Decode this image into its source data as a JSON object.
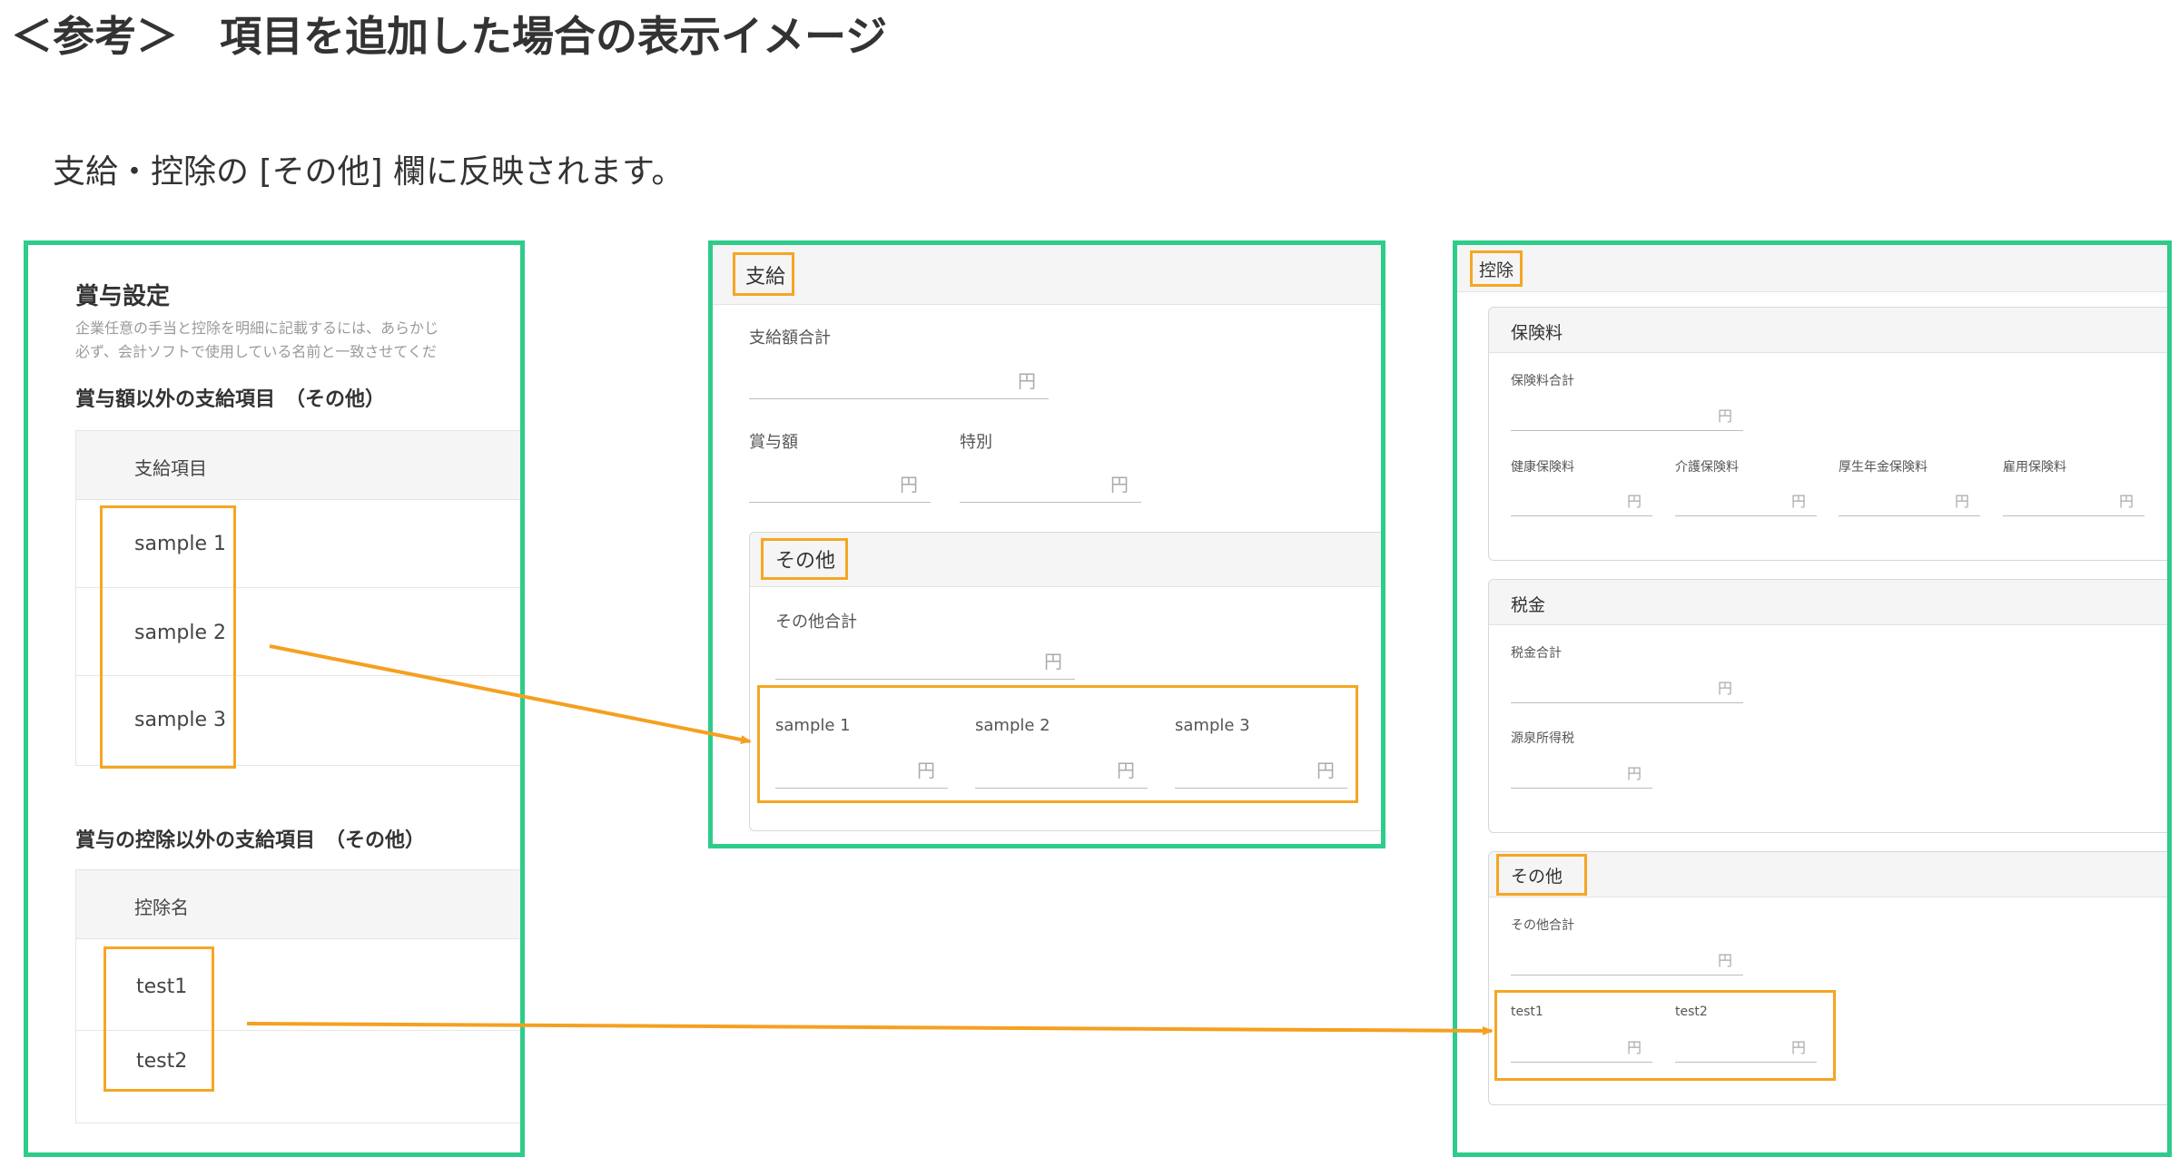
{
  "title": "＜参考＞　項目を追加した場合の表示イメージ",
  "description": "支給・控除の [その他] 欄に反映されます。",
  "colors": {
    "highlight": "#f5a623",
    "frame": "#2ecc8a",
    "arrow": "#f5a020"
  },
  "panel1": {
    "title": "賞与設定",
    "desc_line1": "企業任意の手当と控除を明細に記載するには、あらかじ",
    "desc_line2": "必ず、会計ソフトで使用している名前と一致させてくだ",
    "section_payment": "賞与額以外の支給項目　（その他）",
    "payment_header": "支給項目",
    "payment_items": [
      "sample 1",
      "sample 2",
      "sample 3"
    ],
    "section_deduction": "賞与の控除以外の支給項目　（その他）",
    "deduction_header": "控除名",
    "deduction_items": [
      "test1",
      "test2"
    ]
  },
  "panel2": {
    "header": "支給",
    "total_label": "支給額合計",
    "bonus_label": "賞与額",
    "special_label": "特別",
    "yen": "円",
    "other_header": "その他",
    "other_total_label": "その他合計",
    "other_items": [
      "sample 1",
      "sample 2",
      "sample 3"
    ]
  },
  "panel3": {
    "header": "控除",
    "insurance_title": "保険料",
    "insurance_total_label": "保険料合計",
    "insurance_items": [
      "健康保険料",
      "介護保険料",
      "厚生年金保険料",
      "雇用保険料"
    ],
    "tax_title": "税金",
    "tax_total_label": "税金合計",
    "withholding_label": "源泉所得税",
    "other_header": "その他",
    "other_total_label": "その他合計",
    "other_items": [
      "test1",
      "test2"
    ],
    "yen": "円"
  }
}
